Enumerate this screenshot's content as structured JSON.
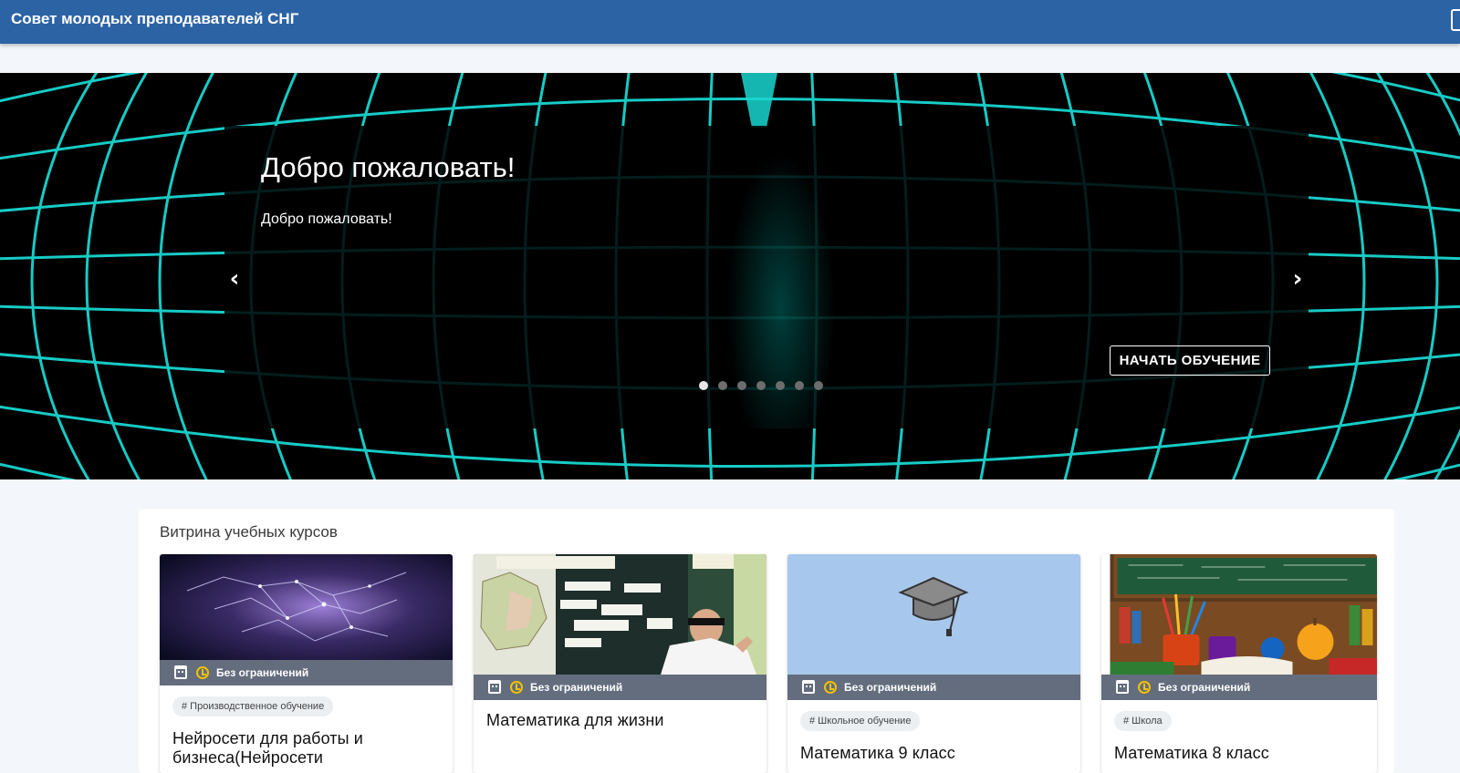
{
  "header": {
    "site_title": "Совет молодых преподавателей СНГ"
  },
  "hero": {
    "slide_title": "Добро пожаловать!",
    "slide_text": "Добро пожаловать!",
    "cta_label": "НАЧАТЬ ОБУЧЕНИЕ",
    "prev_glyph": "‹",
    "next_glyph": "›",
    "slide_count": 7,
    "active_slide": 1,
    "globe_color": "#19d6d0"
  },
  "showcase": {
    "title": "Витрина учебных курсов",
    "cards": [
      {
        "badge": "Без ограничений",
        "tag": "# Производственное обучение",
        "title": "Нейросети для работы и бизнеса(Нейросети",
        "image": "neural-network-image"
      },
      {
        "badge": "Без ограничений",
        "tag": "",
        "title": "Математика для жизни",
        "image": "classroom-teacher-image"
      },
      {
        "badge": "Без ограничений",
        "tag": "# Школьное обучение",
        "title": "Математика 9 класс",
        "image": "graduation-cap-image"
      },
      {
        "badge": "Без ограничений",
        "tag": "# Школа",
        "title": "Математика 8 класс",
        "image": "school-supplies-image"
      }
    ]
  },
  "colors": {
    "header_bg": "#2c63a5",
    "page_bg": "#f3f6fa",
    "badge_clock": "#f2c200"
  }
}
